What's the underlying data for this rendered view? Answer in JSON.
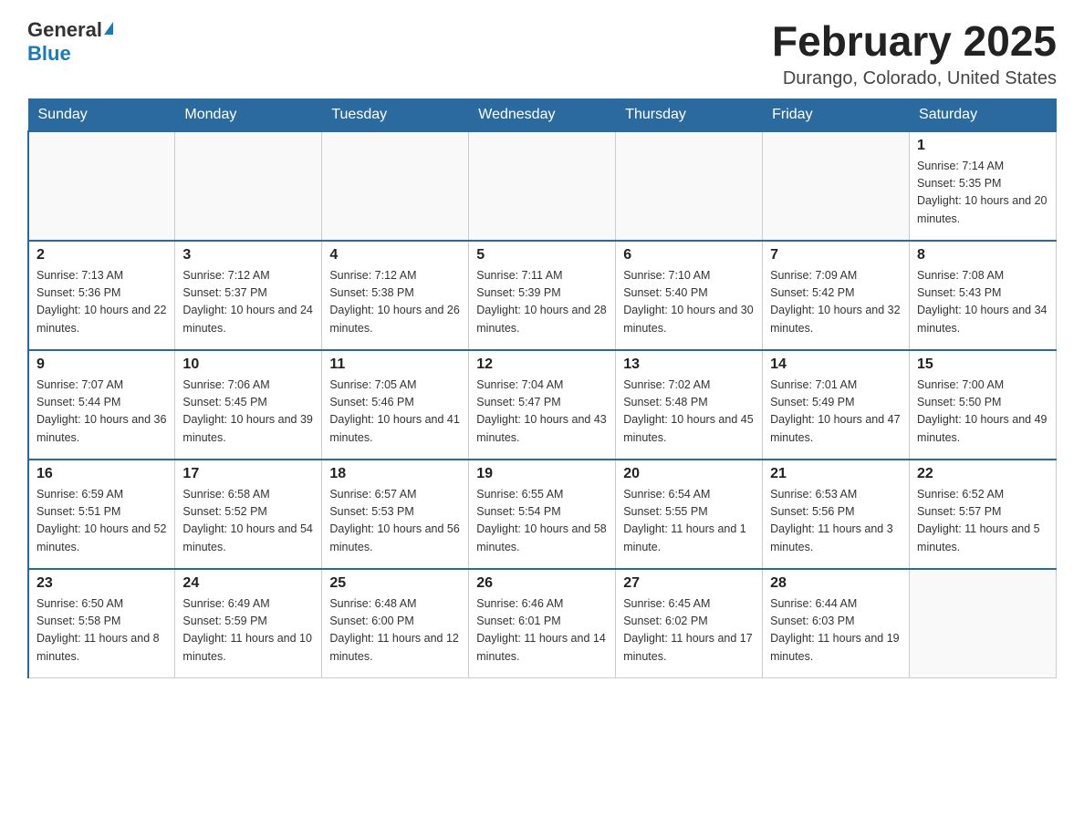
{
  "header": {
    "logo": {
      "general": "General",
      "blue": "Blue",
      "triangle": "▶"
    },
    "title": "February 2025",
    "location": "Durango, Colorado, United States"
  },
  "days_of_week": [
    "Sunday",
    "Monday",
    "Tuesday",
    "Wednesday",
    "Thursday",
    "Friday",
    "Saturday"
  ],
  "weeks": [
    [
      {
        "day": null,
        "info": null
      },
      {
        "day": null,
        "info": null
      },
      {
        "day": null,
        "info": null
      },
      {
        "day": null,
        "info": null
      },
      {
        "day": null,
        "info": null
      },
      {
        "day": null,
        "info": null
      },
      {
        "day": "1",
        "info": "Sunrise: 7:14 AM\nSunset: 5:35 PM\nDaylight: 10 hours and 20 minutes."
      }
    ],
    [
      {
        "day": "2",
        "info": "Sunrise: 7:13 AM\nSunset: 5:36 PM\nDaylight: 10 hours and 22 minutes."
      },
      {
        "day": "3",
        "info": "Sunrise: 7:12 AM\nSunset: 5:37 PM\nDaylight: 10 hours and 24 minutes."
      },
      {
        "day": "4",
        "info": "Sunrise: 7:12 AM\nSunset: 5:38 PM\nDaylight: 10 hours and 26 minutes."
      },
      {
        "day": "5",
        "info": "Sunrise: 7:11 AM\nSunset: 5:39 PM\nDaylight: 10 hours and 28 minutes."
      },
      {
        "day": "6",
        "info": "Sunrise: 7:10 AM\nSunset: 5:40 PM\nDaylight: 10 hours and 30 minutes."
      },
      {
        "day": "7",
        "info": "Sunrise: 7:09 AM\nSunset: 5:42 PM\nDaylight: 10 hours and 32 minutes."
      },
      {
        "day": "8",
        "info": "Sunrise: 7:08 AM\nSunset: 5:43 PM\nDaylight: 10 hours and 34 minutes."
      }
    ],
    [
      {
        "day": "9",
        "info": "Sunrise: 7:07 AM\nSunset: 5:44 PM\nDaylight: 10 hours and 36 minutes."
      },
      {
        "day": "10",
        "info": "Sunrise: 7:06 AM\nSunset: 5:45 PM\nDaylight: 10 hours and 39 minutes."
      },
      {
        "day": "11",
        "info": "Sunrise: 7:05 AM\nSunset: 5:46 PM\nDaylight: 10 hours and 41 minutes."
      },
      {
        "day": "12",
        "info": "Sunrise: 7:04 AM\nSunset: 5:47 PM\nDaylight: 10 hours and 43 minutes."
      },
      {
        "day": "13",
        "info": "Sunrise: 7:02 AM\nSunset: 5:48 PM\nDaylight: 10 hours and 45 minutes."
      },
      {
        "day": "14",
        "info": "Sunrise: 7:01 AM\nSunset: 5:49 PM\nDaylight: 10 hours and 47 minutes."
      },
      {
        "day": "15",
        "info": "Sunrise: 7:00 AM\nSunset: 5:50 PM\nDaylight: 10 hours and 49 minutes."
      }
    ],
    [
      {
        "day": "16",
        "info": "Sunrise: 6:59 AM\nSunset: 5:51 PM\nDaylight: 10 hours and 52 minutes."
      },
      {
        "day": "17",
        "info": "Sunrise: 6:58 AM\nSunset: 5:52 PM\nDaylight: 10 hours and 54 minutes."
      },
      {
        "day": "18",
        "info": "Sunrise: 6:57 AM\nSunset: 5:53 PM\nDaylight: 10 hours and 56 minutes."
      },
      {
        "day": "19",
        "info": "Sunrise: 6:55 AM\nSunset: 5:54 PM\nDaylight: 10 hours and 58 minutes."
      },
      {
        "day": "20",
        "info": "Sunrise: 6:54 AM\nSunset: 5:55 PM\nDaylight: 11 hours and 1 minute."
      },
      {
        "day": "21",
        "info": "Sunrise: 6:53 AM\nSunset: 5:56 PM\nDaylight: 11 hours and 3 minutes."
      },
      {
        "day": "22",
        "info": "Sunrise: 6:52 AM\nSunset: 5:57 PM\nDaylight: 11 hours and 5 minutes."
      }
    ],
    [
      {
        "day": "23",
        "info": "Sunrise: 6:50 AM\nSunset: 5:58 PM\nDaylight: 11 hours and 8 minutes."
      },
      {
        "day": "24",
        "info": "Sunrise: 6:49 AM\nSunset: 5:59 PM\nDaylight: 11 hours and 10 minutes."
      },
      {
        "day": "25",
        "info": "Sunrise: 6:48 AM\nSunset: 6:00 PM\nDaylight: 11 hours and 12 minutes."
      },
      {
        "day": "26",
        "info": "Sunrise: 6:46 AM\nSunset: 6:01 PM\nDaylight: 11 hours and 14 minutes."
      },
      {
        "day": "27",
        "info": "Sunrise: 6:45 AM\nSunset: 6:02 PM\nDaylight: 11 hours and 17 minutes."
      },
      {
        "day": "28",
        "info": "Sunrise: 6:44 AM\nSunset: 6:03 PM\nDaylight: 11 hours and 19 minutes."
      },
      {
        "day": null,
        "info": null
      }
    ]
  ]
}
